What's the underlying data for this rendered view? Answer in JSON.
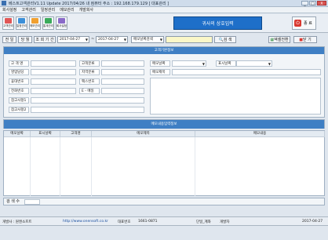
{
  "window": {
    "title": "베스트고객관리V1.11 Update 2017/04/26    내 컴퓨터 주소 : 192.168.179.129   [ 대표관리 ]",
    "controls": [
      "_",
      "□",
      "X"
    ]
  },
  "menu": [
    "회사설정",
    "고객관리",
    "일정관리",
    "메모관리",
    "개발회사"
  ],
  "toolbar": {
    "buttons": [
      {
        "label": "고객관리",
        "color": "#e05656"
      },
      {
        "label": "일정관리",
        "color": "#3b8fd8"
      },
      {
        "label": "메모관리",
        "color": "#f0a030"
      },
      {
        "label": "통계관리",
        "color": "#3aaa5a"
      },
      {
        "label": "회사설정",
        "color": "#8a6ac8"
      }
    ],
    "brand": "귀사의 상호입력",
    "exit_label": "종 료"
  },
  "search": {
    "today_label": "전 일",
    "month_label": "당 월",
    "period_label": "조 회 기 간",
    "date_from": "2017-04-27",
    "date_to": "2017-04-27",
    "field_select": "메모날짜검색",
    "search_button": "검 색",
    "excel_label": "엑셀전환",
    "close_label": "닫 기"
  },
  "customer_panel": {
    "title": "고객기본정보",
    "fields": [
      "고 객 명",
      "영업담당",
      "휴대번호",
      "전화번호",
      "참고사항1",
      "참고사항2"
    ],
    "fields_right": [
      "고객분류",
      "지역분류",
      "팩스번호",
      "E - 메일"
    ]
  },
  "memo_input": {
    "date_label": "메모날짜",
    "type_label": "표시날짜",
    "title_label": "메모제목"
  },
  "memo_panel": {
    "title": "메모내용입력정보"
  },
  "grid": {
    "columns": [
      "메모날짜",
      "표시날짜",
      "고객명",
      "메모제목",
      "메모내용"
    ]
  },
  "count_label": "검 색 수",
  "info": {
    "developer": "개발사 : 원앤소프트",
    "website": "http://www.onensoft.co.kr",
    "phone_label": "대표번호",
    "phone": "1661-0871",
    "user": "단일_계좌",
    "role": "개발자",
    "date": "2017-04-27"
  }
}
